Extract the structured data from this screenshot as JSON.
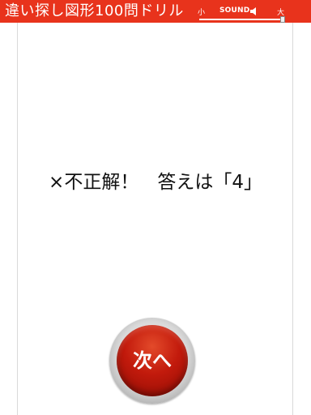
{
  "app": {
    "title": "違い探し図形100問ドリル"
  },
  "volume": {
    "min_label": "小",
    "sound_label": "SOUND",
    "max_label": "大",
    "level": 1.0,
    "speaker_icon": "speaker-icon"
  },
  "result": {
    "message": "×不正解！　答えは「4」"
  },
  "next_button": {
    "label": "次へ"
  },
  "colors": {
    "header": "#e8331c",
    "button_red": "#c21a0c"
  }
}
